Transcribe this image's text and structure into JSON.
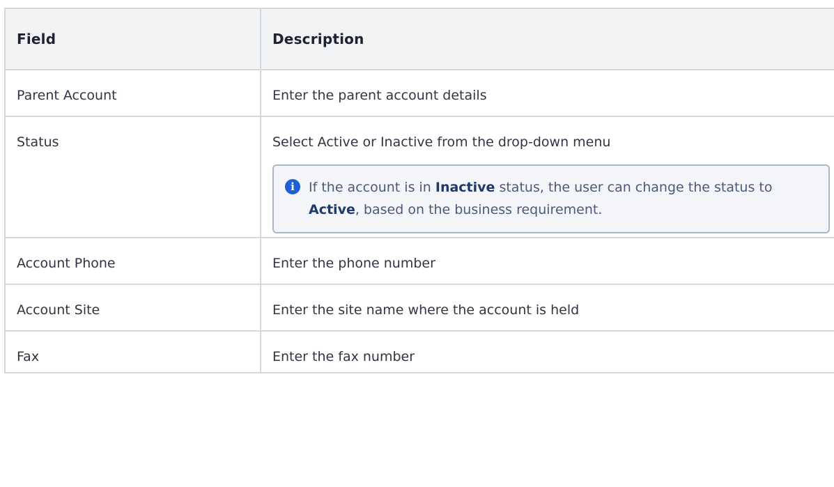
{
  "table": {
    "headers": [
      "Field",
      "Description"
    ],
    "rows": [
      {
        "field": "Parent Account",
        "description": "Enter the parent account details"
      },
      {
        "field": "Status",
        "description": "Select Active or Inactive from the drop-down menu"
      },
      {
        "field": "Account Phone",
        "description": "Enter the phone number"
      },
      {
        "field": "Account Site",
        "description": "Enter the site name where the account is held"
      },
      {
        "field": "Fax",
        "description": "Enter the fax number"
      }
    ]
  },
  "note": {
    "icon": "info-icon",
    "text_1": "If the account is in ",
    "bold_1": "Inactive",
    "text_2": " status, the user can change the status to ",
    "bold_2": "Active",
    "text_3": ", based on the business requirement."
  },
  "colors": {
    "header_bg": "#f2f3f5",
    "border": "#d4d7dc",
    "note_bg": "#f3f5f8",
    "note_border": "#a9b7c6",
    "info_icon": "#1f5fd6"
  }
}
